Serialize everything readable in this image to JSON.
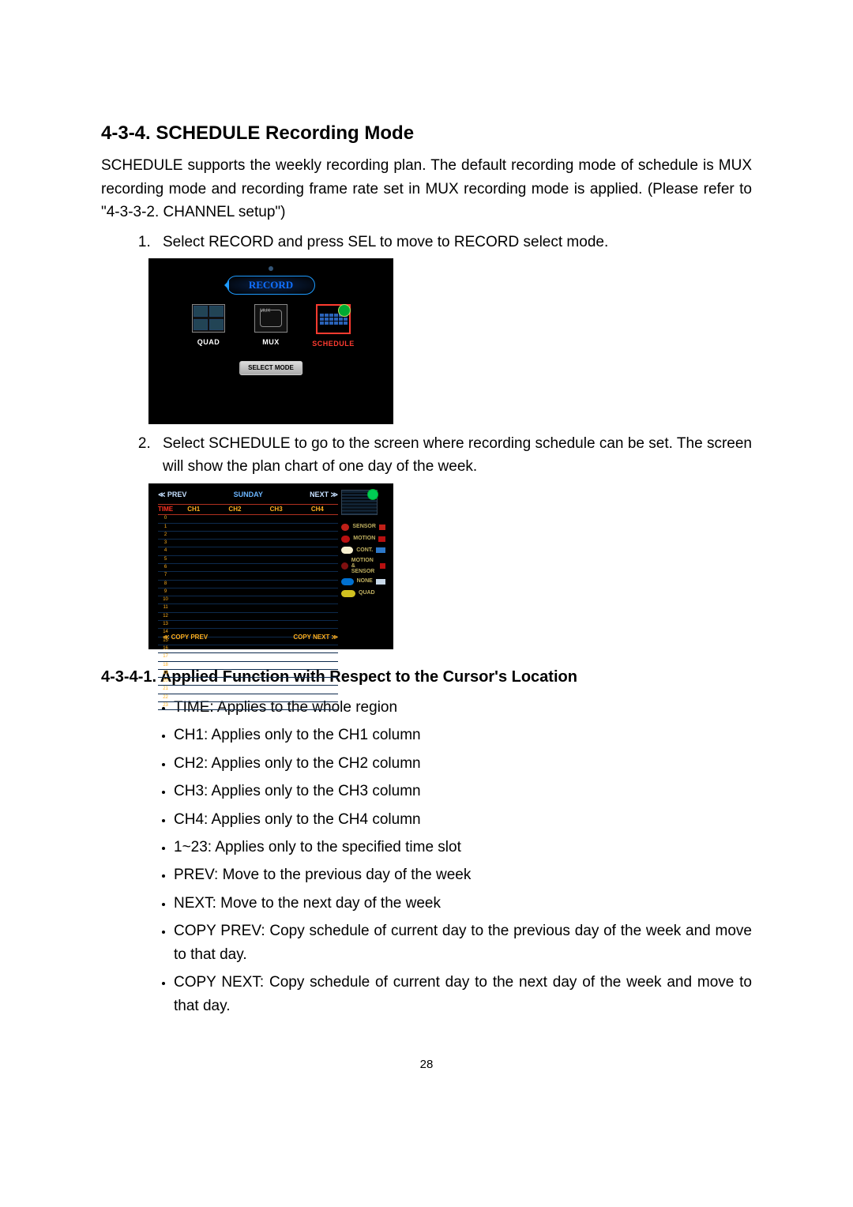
{
  "heading": "4-3-4. SCHEDULE Recording Mode",
  "intro": "SCHEDULE supports the weekly recording plan. The default recording mode of schedule is MUX recording mode and recording frame rate set in MUX recording mode is applied. (Please refer to \"4-3-3-2. CHANNEL setup\")",
  "steps": {
    "s1": "Select RECORD and press SEL to move to RECORD select mode.",
    "s2": "Select SCHEDULE to go to the screen where recording schedule can be set. The screen will show the plan chart of one day of the week."
  },
  "shotA": {
    "banner": "RECORD",
    "quad": "QUAD",
    "mux": "MUX",
    "schedule": "SCHEDULE",
    "selectmode": "SELECT MODE"
  },
  "shotB": {
    "prev": "≪ PREV",
    "next": "NEXT ≫",
    "day": "SUNDAY",
    "headers": {
      "time": "TIME",
      "c1": "CH1",
      "c2": "CH2",
      "c3": "CH3",
      "c4": "CH4"
    },
    "copy_prev": "≪ COPY PREV",
    "copy_next": "COPY NEXT ≫",
    "legend": {
      "sensor": "SENSOR",
      "motion": "MOTION",
      "cont": "CONT.",
      "motion_sensor": "MOTION & SENSOR",
      "none": "NONE",
      "quad": "QUAD"
    },
    "time_rows": [
      "0",
      "1",
      "2",
      "3",
      "4",
      "5",
      "6",
      "7",
      "8",
      "9",
      "10",
      "11",
      "12",
      "13",
      "14",
      "15",
      "16",
      "17",
      "18",
      "19",
      "20",
      "21",
      "22",
      "23"
    ]
  },
  "subheading": "4-3-4-1. Applied Function with Respect to the Cursor's Location",
  "bullets": {
    "b1": "TIME: Applies to the whole region",
    "b2": "CH1: Applies only to the CH1 column",
    "b3": "CH2: Applies only to the CH2 column",
    "b4": "CH3: Applies only to the CH3 column",
    "b5": "CH4: Applies only to the CH4 column",
    "b6": "1~23: Applies only to the specified time slot",
    "b7": "PREV: Move to the previous day of the week",
    "b8": "NEXT: Move to the next day of the week",
    "b9": "COPY PREV: Copy schedule of current day to the previous day of the week and move to that day.",
    "b10": "COPY NEXT: Copy schedule of current day to the next day of the week and move to that day."
  },
  "page_number": "28"
}
